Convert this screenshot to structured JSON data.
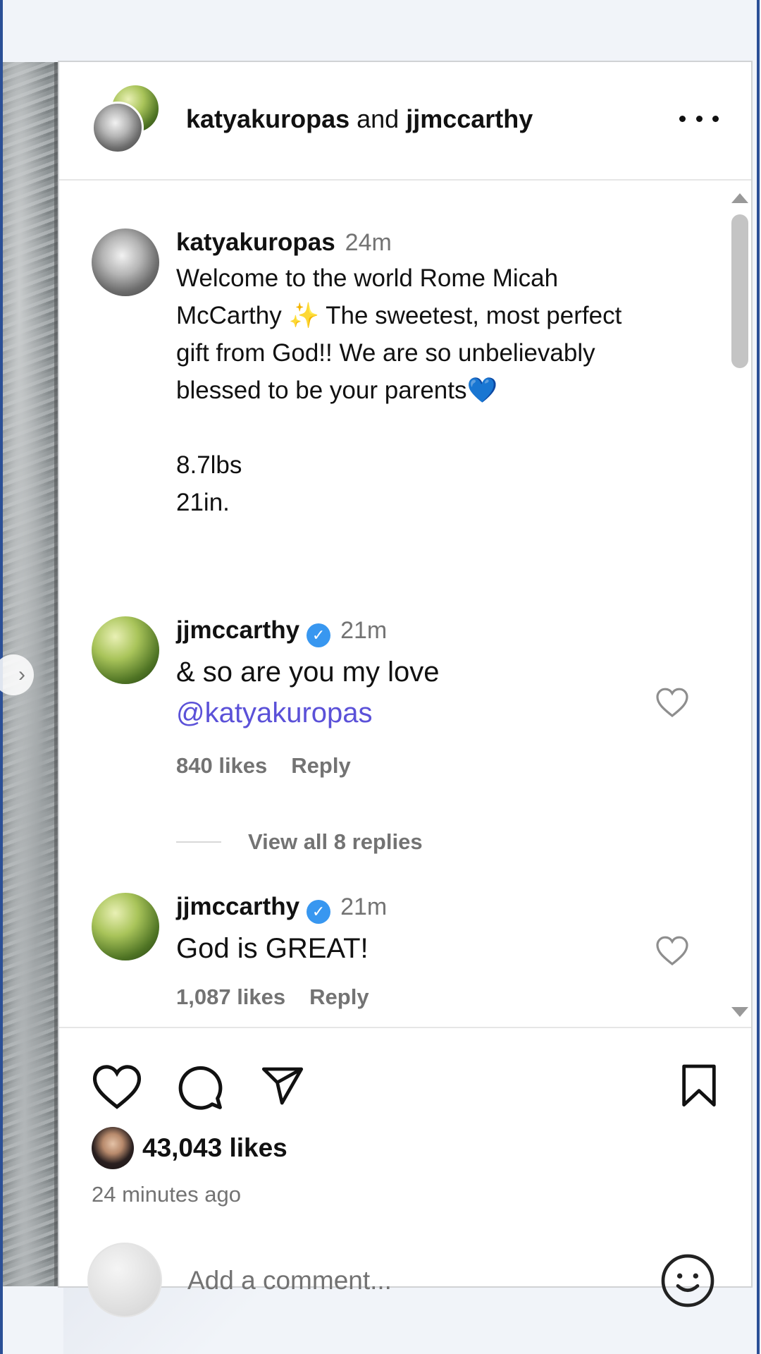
{
  "post": {
    "header": {
      "user1": "katyakuropas",
      "joiner": " and ",
      "user2": "jjmccarthy"
    },
    "caption": {
      "username": "katyakuropas",
      "time": "24m",
      "lines": [
        "Welcome to the world Rome Micah",
        "McCarthy ✨ The sweetest, most perfect",
        "gift from God!! We are so unbelievably",
        "blessed to be your parents💙"
      ],
      "weight": "8.7lbs",
      "length": "21in."
    },
    "comments": [
      {
        "username": "jjmccarthy",
        "time": "21m",
        "text": "& so are you my love",
        "mention": "@katyakuropas",
        "likes": "840 likes",
        "reply": "Reply",
        "view_replies": "View all 8 replies"
      },
      {
        "username": "jjmccarthy",
        "time": "21m",
        "text": "God is GREAT!",
        "likes": "1,087 likes",
        "reply": "Reply"
      }
    ],
    "like_count": "43,043 likes",
    "time_ago": "24 minutes ago",
    "add_comment_placeholder": "Add a comment..."
  },
  "icons": {
    "more": "more-options-icon",
    "like": "heart-icon",
    "comment": "comment-bubble-icon",
    "share": "paper-plane-icon",
    "save": "bookmark-icon",
    "emoji": "smiley-icon",
    "verified": "verified-badge-icon",
    "carousel": "chevron-right-icon"
  },
  "colors": {
    "accent_mention": "#5b51d8",
    "verified": "#3897f0",
    "muted_text": "#737373",
    "window_frame": "#2b4f96"
  }
}
